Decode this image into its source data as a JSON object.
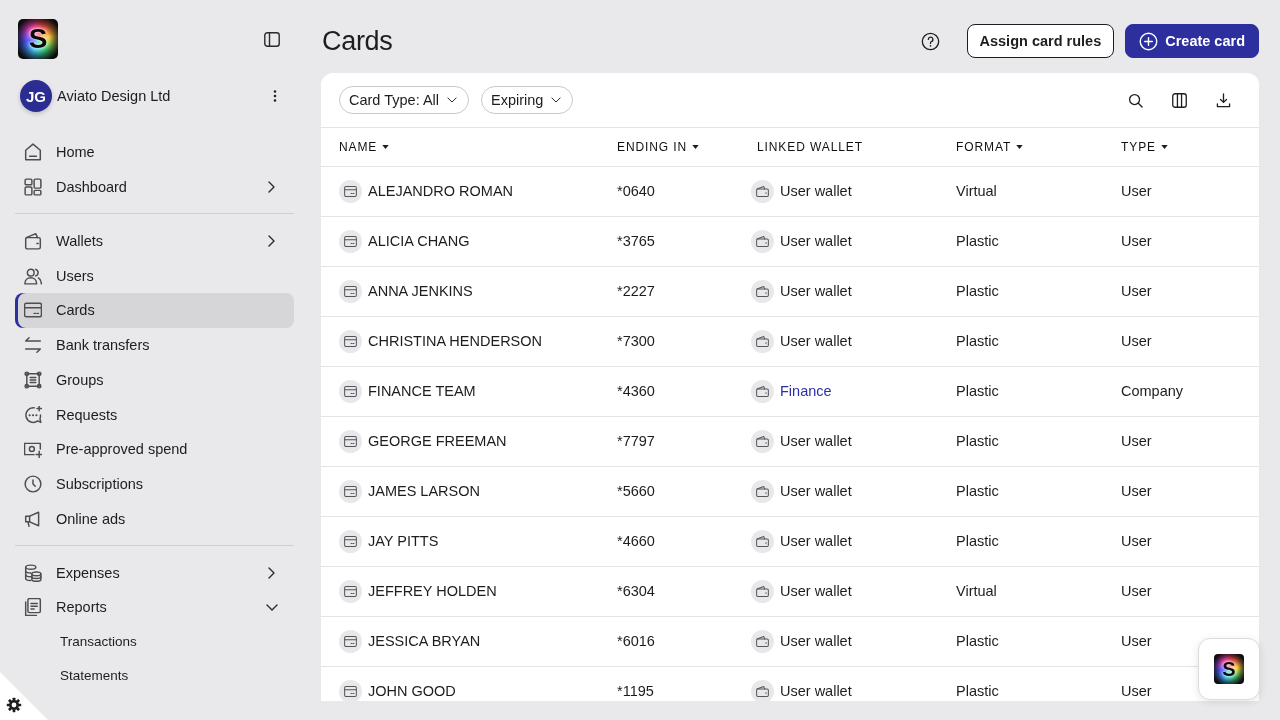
{
  "sidebar": {
    "logo": {
      "mark": "S"
    },
    "organization": {
      "initials": "JG",
      "name": "Aviato Design Ltd"
    },
    "nav_sections": [
      {
        "items": [
          {
            "label": "Home",
            "selected": false
          },
          {
            "label": "Dashboard",
            "selected": false,
            "expanded": false
          }
        ]
      },
      {
        "items": [
          {
            "label": "Wallets",
            "selected": false,
            "expanded": false
          },
          {
            "label": "Users",
            "selected": false
          },
          {
            "label": "Cards",
            "selected": true
          },
          {
            "label": "Bank transfers",
            "selected": false
          },
          {
            "label": "Groups",
            "selected": false
          },
          {
            "label": "Requests",
            "selected": false
          },
          {
            "label": "Pre-approved spend",
            "selected": false
          },
          {
            "label": "Subscriptions",
            "selected": false
          },
          {
            "label": "Online ads",
            "selected": false
          }
        ]
      },
      {
        "items": [
          {
            "label": "Expenses",
            "selected": false,
            "expanded": false
          },
          {
            "label": "Reports",
            "selected": false,
            "expanded": true,
            "children": [
              {
                "label": "Transactions",
                "selected": false
              },
              {
                "label": "Statements",
                "selected": false
              }
            ]
          }
        ]
      }
    ]
  },
  "header": {
    "title": "Cards",
    "buttons": [
      {
        "label": "Assign card rules",
        "kind": "secondary"
      },
      {
        "label": "Create card",
        "kind": "primary"
      }
    ]
  },
  "filters": [
    {
      "label": "Card Type: All"
    },
    {
      "label": "Expiring"
    }
  ],
  "table": {
    "columns": [
      {
        "label": "NAME",
        "sortable": true
      },
      {
        "label": "ENDING IN",
        "sortable": true
      },
      {
        "label": "LINKED WALLET",
        "sortable": false
      },
      {
        "label": "FORMAT",
        "sortable": true
      },
      {
        "label": "TYPE",
        "sortable": true
      }
    ],
    "rows": [
      {
        "name": "ALEJANDRO ROMAN",
        "ending_in": "*0640",
        "linked_wallet": {
          "label": "User wallet",
          "link": false
        },
        "format": "Virtual",
        "type": "User"
      },
      {
        "name": "ALICIA CHANG",
        "ending_in": "*3765",
        "linked_wallet": {
          "label": "User wallet",
          "link": false
        },
        "format": "Plastic",
        "type": "User"
      },
      {
        "name": "ANNA JENKINS",
        "ending_in": "*2227",
        "linked_wallet": {
          "label": "User wallet",
          "link": false
        },
        "format": "Plastic",
        "type": "User"
      },
      {
        "name": "CHRISTINA HENDERSON",
        "ending_in": "*7300",
        "linked_wallet": {
          "label": "User wallet",
          "link": false
        },
        "format": "Plastic",
        "type": "User"
      },
      {
        "name": "FINANCE TEAM",
        "ending_in": "*4360",
        "linked_wallet": {
          "label": "Finance",
          "link": true
        },
        "format": "Plastic",
        "type": "Company"
      },
      {
        "name": "GEORGE FREEMAN",
        "ending_in": "*7797",
        "linked_wallet": {
          "label": "User wallet",
          "link": false
        },
        "format": "Plastic",
        "type": "User"
      },
      {
        "name": "JAMES LARSON",
        "ending_in": "*5660",
        "linked_wallet": {
          "label": "User wallet",
          "link": false
        },
        "format": "Plastic",
        "type": "User"
      },
      {
        "name": "JAY PITTS",
        "ending_in": "*4660",
        "linked_wallet": {
          "label": "User wallet",
          "link": false
        },
        "format": "Plastic",
        "type": "User"
      },
      {
        "name": "JEFFREY HOLDEN",
        "ending_in": "*6304",
        "linked_wallet": {
          "label": "User wallet",
          "link": false
        },
        "format": "Virtual",
        "type": "User"
      },
      {
        "name": "JESSICA BRYAN",
        "ending_in": "*6016",
        "linked_wallet": {
          "label": "User wallet",
          "link": false
        },
        "format": "Plastic",
        "type": "User"
      },
      {
        "name": "JOHN GOOD",
        "ending_in": "*1195",
        "linked_wallet": {
          "label": "User wallet",
          "link": false
        },
        "format": "Plastic",
        "type": "User"
      }
    ]
  },
  "chat_widget": {
    "mark": "S"
  }
}
